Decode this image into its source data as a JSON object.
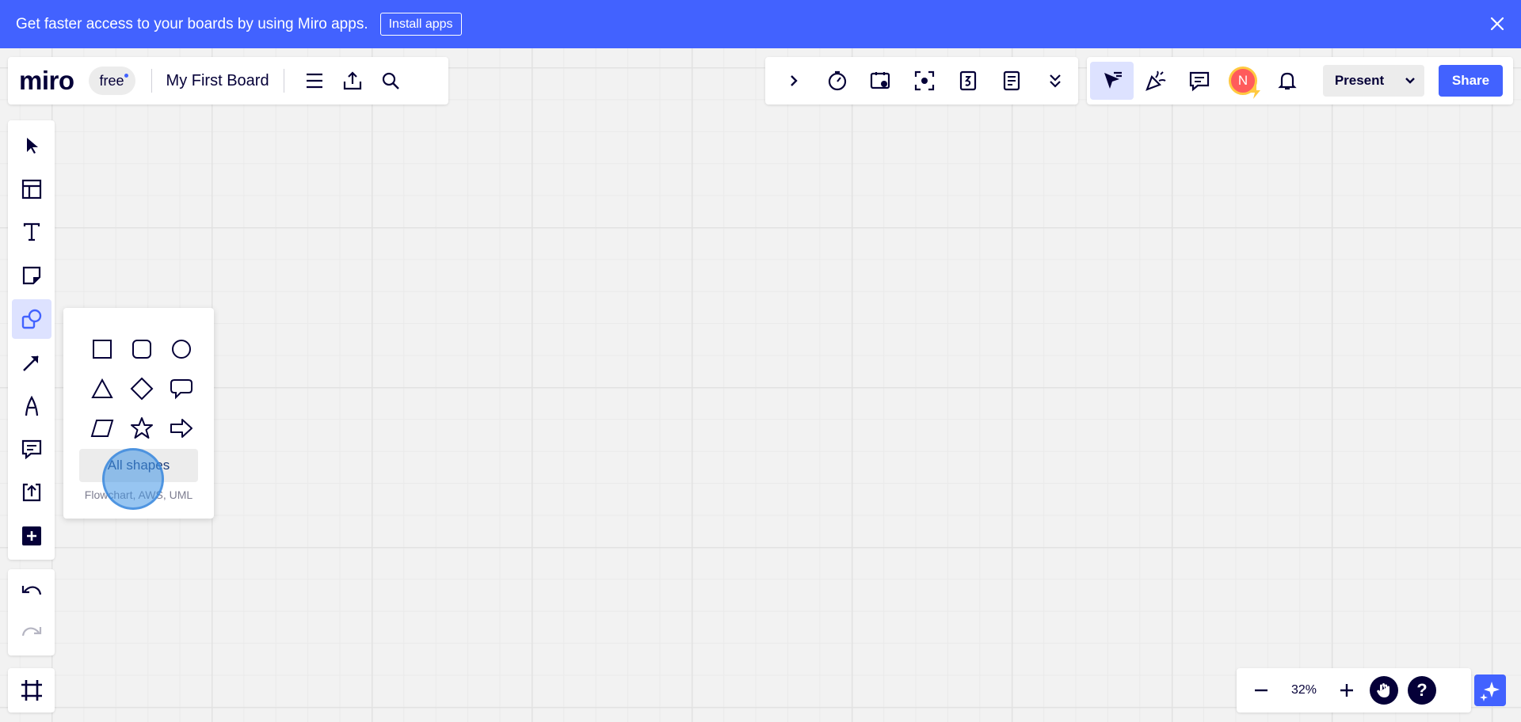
{
  "banner": {
    "message": "Get faster access to your boards by using Miro apps.",
    "install_label": "Install apps",
    "color": "#4262ff"
  },
  "board": {
    "logo": "miro",
    "plan": "free",
    "name": "My First Board"
  },
  "collab": {
    "avatar_initial": "N",
    "present_label": "Present",
    "share_label": "Share"
  },
  "shapes_popup": {
    "shapes": [
      "rectangle",
      "rounded-rectangle",
      "circle",
      "triangle",
      "diamond",
      "speech-bubble",
      "parallelogram",
      "star",
      "arrow-right"
    ],
    "all_shapes_label": "All shapes",
    "all_shapes_sub": "Flowchart, AWS, UML"
  },
  "zoom": {
    "value": "32%"
  },
  "colors": {
    "accent": "#4262ff",
    "active_bg": "#dde2ff",
    "ink": "#050038"
  }
}
